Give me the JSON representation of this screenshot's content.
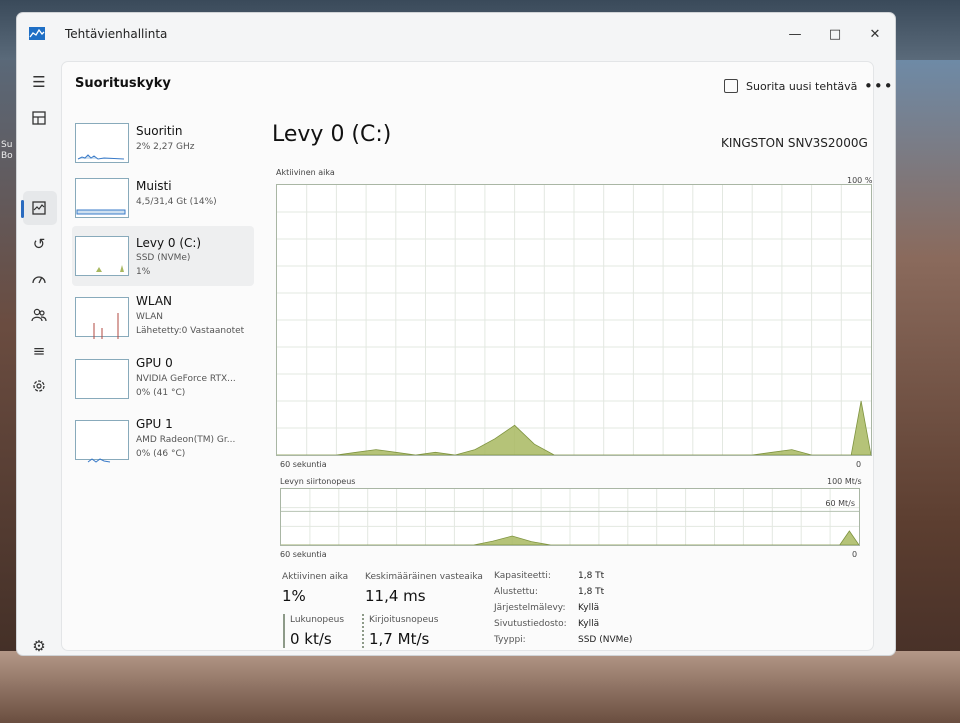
{
  "window": {
    "title": "Tehtävienhallinta"
  },
  "page": {
    "title": "Suorituskyky",
    "run_new_task": "Suorita uusi tehtävä",
    "more": "•••"
  },
  "desktop_text": [
    "Su",
    "Bo"
  ],
  "nav": {
    "icons": [
      "hamburger-icon",
      "processes-icon",
      "performance-icon",
      "app-history-icon",
      "startup-apps-icon",
      "users-icon",
      "details-icon",
      "services-icon",
      "settings-icon"
    ]
  },
  "devices": [
    {
      "name": "Suoritin",
      "sub1": "2% 2,27 GHz",
      "sub2": ""
    },
    {
      "name": "Muisti",
      "sub1": "4,5/31,4 Gt (14%)",
      "sub2": ""
    },
    {
      "name": "Levy 0 (C:)",
      "sub1": "SSD (NVMe)",
      "sub2": "1%"
    },
    {
      "name": "WLAN",
      "sub1": "WLAN",
      "sub2": "Lähetetty:0 Vastaanotet"
    },
    {
      "name": "GPU 0",
      "sub1": "NVIDIA GeForce RTX...",
      "sub2": "0% (41 °C)"
    },
    {
      "name": "GPU 1",
      "sub1": "AMD Radeon(TM) Gr...",
      "sub2": "0% (46 °C)"
    }
  ],
  "disk": {
    "title": "Levy 0 (C:)",
    "model": "KINGSTON SNV3S2000G",
    "chart1": {
      "label": "Aktiivinen aika",
      "max_label": "100 %",
      "x_left": "60 sekuntia",
      "x_right": "0"
    },
    "chart2": {
      "label": "Levyn siirtonopeus",
      "max_label": "100 Mt/s",
      "mid_label": "60 Mt/s",
      "x_left": "60 sekuntia",
      "x_right": "0"
    },
    "stats": {
      "active_time_label": "Aktiivinen aika",
      "active_time_value": "1%",
      "avg_response_label": "Keskimääräinen vasteaika",
      "avg_response_value": "11,4 ms",
      "read_label": "Lukunopeus",
      "read_value": "0 kt/s",
      "write_label": "Kirjoitusnopeus",
      "write_value": "1,7 Mt/s"
    },
    "properties": [
      {
        "label": "Kapasiteetti:",
        "value": "1,8 Tt"
      },
      {
        "label": "Alustettu:",
        "value": "1,8 Tt"
      },
      {
        "label": "Järjestelmälevy:",
        "value": "Kyllä"
      },
      {
        "label": "Sivutustiedosto:",
        "value": "Kyllä"
      },
      {
        "label": "Tyyppi:",
        "value": "SSD (NVMe)"
      }
    ]
  },
  "chart_data": [
    {
      "type": "area",
      "title": "Aktiivinen aika",
      "xlabel": "60 sekuntia",
      "ylabel": "",
      "xlim": [
        60,
        0
      ],
      "ylim": [
        0,
        100
      ],
      "x": [
        60,
        56,
        54,
        52,
        50,
        48,
        46,
        44,
        42,
        40,
        38,
        36,
        34,
        32,
        30,
        28,
        26,
        24,
        22,
        20,
        18,
        16,
        14,
        12,
        10,
        8,
        6,
        4,
        2,
        1,
        0
      ],
      "series": [
        {
          "values": [
            0,
            0,
            0,
            1,
            2,
            1,
            0,
            1,
            0,
            2,
            6,
            11,
            4,
            0,
            0,
            0,
            0,
            0,
            0,
            0,
            0,
            0,
            0,
            0,
            1,
            2,
            0,
            0,
            0,
            20,
            0
          ]
        }
      ],
      "color": "#a8b860"
    },
    {
      "type": "area",
      "title": "Levyn siirtonopeus",
      "xlabel": "60 sekuntia",
      "ylabel": "",
      "xlim": [
        60,
        0
      ],
      "ylim": [
        0,
        100
      ],
      "x": [
        60,
        40,
        38,
        36,
        34,
        32,
        4,
        2,
        1,
        0
      ],
      "series": [
        {
          "values": [
            0,
            0,
            7,
            16,
            6,
            0,
            0,
            0,
            25,
            0
          ]
        }
      ],
      "color": "#a8b860"
    }
  ]
}
